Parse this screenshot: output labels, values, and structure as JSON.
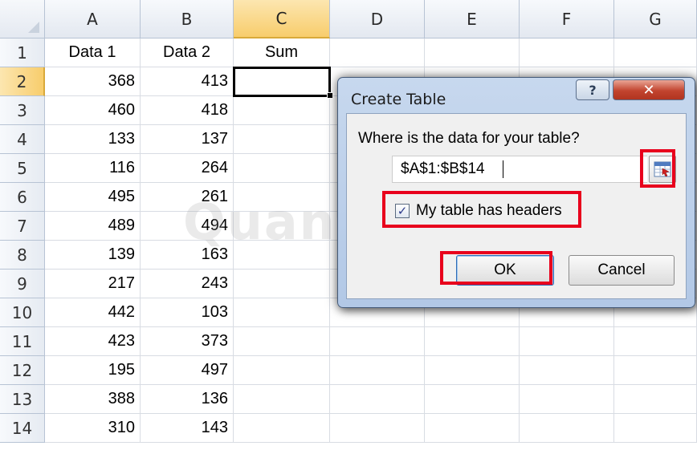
{
  "sheet": {
    "columns": [
      "A",
      "B",
      "C",
      "D",
      "E",
      "F",
      "G"
    ],
    "active_column": "C",
    "rows": [
      "1",
      "2",
      "3",
      "4",
      "5",
      "6",
      "7",
      "8",
      "9",
      "10",
      "11",
      "12",
      "13",
      "14"
    ],
    "active_row": "2",
    "headers": {
      "a": "Data 1",
      "b": "Data 2",
      "c": "Sum"
    },
    "data": [
      [
        "368",
        "413"
      ],
      [
        "460",
        "418"
      ],
      [
        "133",
        "137"
      ],
      [
        "116",
        "264"
      ],
      [
        "495",
        "261"
      ],
      [
        "489",
        "494"
      ],
      [
        "139",
        "163"
      ],
      [
        "217",
        "243"
      ],
      [
        "442",
        "103"
      ],
      [
        "423",
        "373"
      ],
      [
        "195",
        "497"
      ],
      [
        "388",
        "136"
      ],
      [
        "310",
        "143"
      ]
    ],
    "selected_cell": "C2"
  },
  "watermark": "Quantrimang",
  "dialog": {
    "title": "Create Table",
    "help_label": "?",
    "close_label": "✕",
    "prompt": "Where is the data for your table?",
    "range_value": "$A$1:$B$14",
    "headers_checked": true,
    "headers_label": "My table has headers",
    "ok_label": "OK",
    "cancel_label": "Cancel"
  },
  "colors": {
    "highlight": "#e8001c",
    "active_header": "#f8cd6c",
    "dialog_frame": "#b2c8e6"
  },
  "icons": {
    "range_picker": "collapse-dialog-icon",
    "checkbox": "checkmark-icon"
  }
}
